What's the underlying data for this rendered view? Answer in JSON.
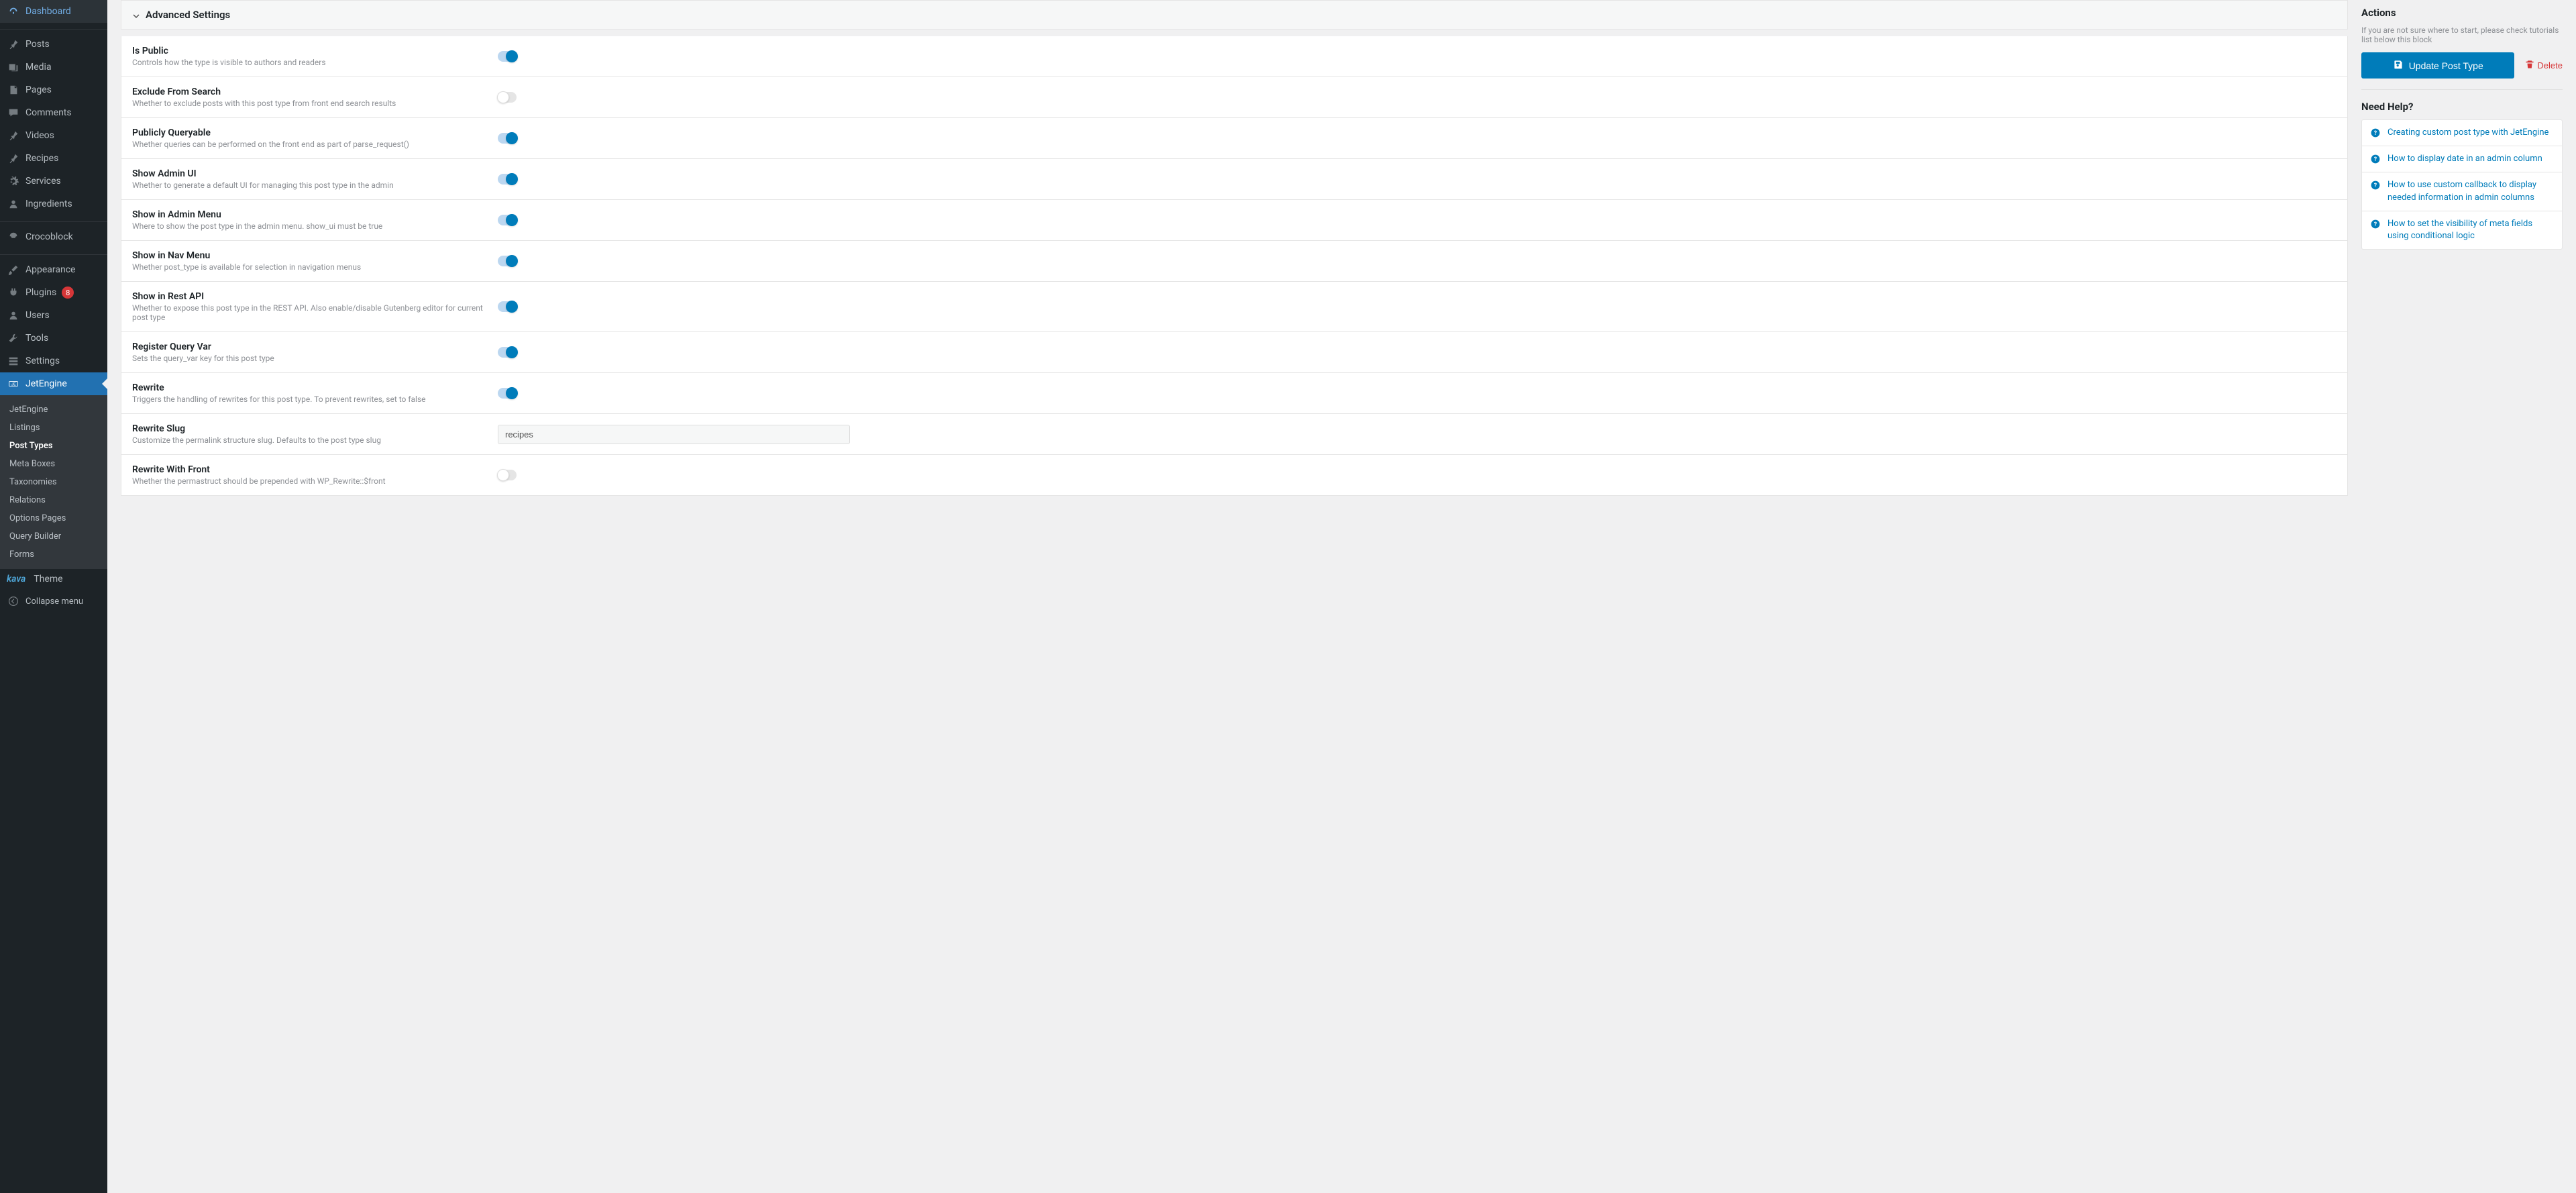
{
  "sidebar": {
    "items": [
      {
        "icon": "dashboard",
        "label": "Dashboard"
      },
      {
        "icon": "pin",
        "label": "Posts"
      },
      {
        "icon": "media",
        "label": "Media"
      },
      {
        "icon": "page",
        "label": "Pages"
      },
      {
        "icon": "comment",
        "label": "Comments"
      },
      {
        "icon": "pin",
        "label": "Videos"
      },
      {
        "icon": "pin",
        "label": "Recipes"
      },
      {
        "icon": "gear",
        "label": "Services"
      },
      {
        "icon": "user",
        "label": "Ingredients"
      },
      {
        "icon": "croco",
        "label": "Crocoblock"
      },
      {
        "icon": "brush",
        "label": "Appearance"
      },
      {
        "icon": "plugin",
        "label": "Plugins",
        "badge": "8"
      },
      {
        "icon": "user",
        "label": "Users"
      },
      {
        "icon": "tool",
        "label": "Tools"
      },
      {
        "icon": "sliders",
        "label": "Settings"
      },
      {
        "icon": "jet",
        "label": "JetEngine"
      }
    ],
    "submenu": [
      {
        "label": "JetEngine"
      },
      {
        "label": "Listings"
      },
      {
        "label": "Post Types",
        "active": true
      },
      {
        "label": "Meta Boxes"
      },
      {
        "label": "Taxonomies"
      },
      {
        "label": "Relations"
      },
      {
        "label": "Options Pages"
      },
      {
        "label": "Query Builder"
      },
      {
        "label": "Forms"
      }
    ],
    "kava_label": "Theme",
    "collapse": "Collapse menu"
  },
  "section": {
    "title": "Advanced Settings",
    "settings": [
      {
        "title": "Is Public",
        "desc": "Controls how the type is visible to authors and readers",
        "type": "toggle",
        "value": true
      },
      {
        "title": "Exclude From Search",
        "desc": "Whether to exclude posts with this post type from front end search results",
        "type": "toggle",
        "value": false
      },
      {
        "title": "Publicly Queryable",
        "desc": "Whether queries can be performed on the front end as part of parse_request()",
        "type": "toggle",
        "value": true
      },
      {
        "title": "Show Admin UI",
        "desc": "Whether to generate a default UI for managing this post type in the admin",
        "type": "toggle",
        "value": true
      },
      {
        "title": "Show in Admin Menu",
        "desc": "Where to show the post type in the admin menu. show_ui must be true",
        "type": "toggle",
        "value": true
      },
      {
        "title": "Show in Nav Menu",
        "desc": "Whether post_type is available for selection in navigation menus",
        "type": "toggle",
        "value": true
      },
      {
        "title": "Show in Rest API",
        "desc": "Whether to expose this post type in the REST API. Also enable/disable Gutenberg editor for current post type",
        "type": "toggle",
        "value": true
      },
      {
        "title": "Register Query Var",
        "desc": "Sets the query_var key for this post type",
        "type": "toggle",
        "value": true
      },
      {
        "title": "Rewrite",
        "desc": "Triggers the handling of rewrites for this post type. To prevent rewrites, set to false",
        "type": "toggle",
        "value": true
      },
      {
        "title": "Rewrite Slug",
        "desc": "Customize the permalink structure slug. Defaults to the post type slug",
        "type": "text",
        "value": "recipes"
      },
      {
        "title": "Rewrite With Front",
        "desc": "Whether the permastruct should be prepended with WP_Rewrite::$front",
        "type": "toggle",
        "value": false
      }
    ]
  },
  "actions": {
    "title": "Actions",
    "hint": "If you are not sure where to start, please check tutorials list below this block",
    "update": "Update Post Type",
    "delete": "Delete"
  },
  "help": {
    "title": "Need Help?",
    "items": [
      "Creating custom post type with JetEngine",
      "How to display date in an admin column",
      "How to use custom callback to display needed information in admin columns",
      "How to set the visibility of meta fields using conditional logic"
    ]
  }
}
